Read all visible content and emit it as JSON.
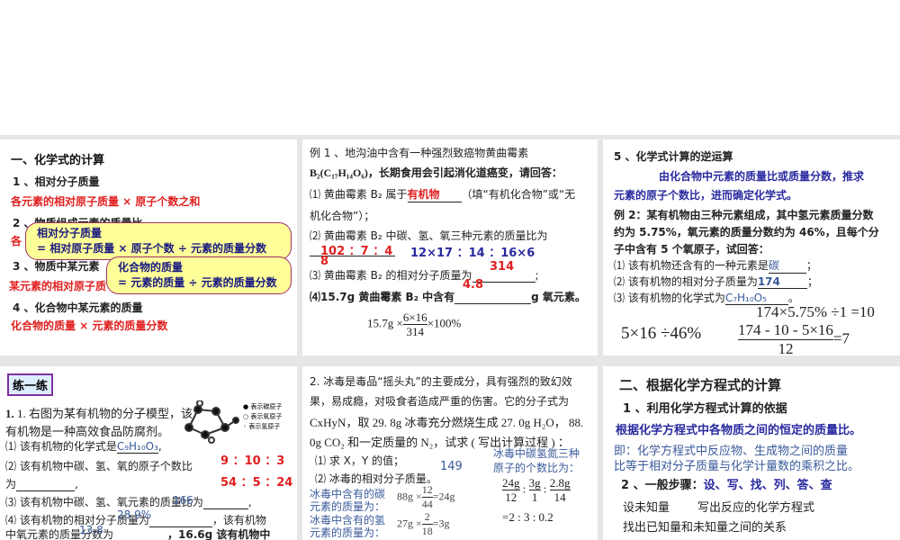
{
  "p1": {
    "title": "一、化学式的计算",
    "s1": "1 、相对分子质量",
    "s1a": "各元素的相对原子质量 × 原子个数之和",
    "s2": "2 、物质组成元素的质量比",
    "s2a": "各",
    "s3": "3 、物质中某元素",
    "s3a": "某元素的相对原子质",
    "s4": "4 、化合物中某元素的质量",
    "s4a": "化合物的质量 × 元素的质量分数",
    "callout1": [
      "相对分子质量",
      "= 相对原子质量 × 原子个数 ÷ 元素的质量分数"
    ],
    "callout2": [
      "化合物的质量",
      "= 元素的质量 ÷ 元素的质量分数"
    ]
  },
  "p2": {
    "l1": "例 1 、地沟油中含有一种强烈致癌物黄曲霉素",
    "l2": "B₂(C₁₇H₁₄O₆)，长期食用会引起消化道癌变，请回答：",
    "q1": "⑴ 黄曲霉素 B₂ 属于",
    "a1": "有机物",
    "q1b": "（填“有机化合物”或“无",
    "q1c": "机化合物”）；",
    "q2": "⑵ 黄曲霉素 B₂ 中碳、氢、氧三种元素的质量比为",
    "a2": "102 ：7 ：4",
    "a2b": "8",
    "a2c": "12×17 ：14 ：16×6",
    "q3": "⑶ 黄曲霉素 B₂ 的相对分子质量为",
    "a3": "314",
    "q4": "⑷15.7g 黄曲霉素 B₂ 中含有",
    "q4b": "g 氧元素。",
    "a4": "4.8",
    "f1": "15.7g ×",
    "fn": "6×16",
    "fd": "314",
    "f2": "×100%"
  },
  "p3": {
    "title": "5 、化学式计算的逆运算",
    "d1": "由化合物中元素的质量比或质量分数，推求",
    "d2": "元素的原子个数比，进而确定化学式。",
    "e1": "例 2：某有机物由三种元素组成，其中氢元素质量分数",
    "e2": "约为 5.75%，氧元素的质量分数约为 46%，且每个分",
    "e3": "子中含有 5 个氧原子，试回答：",
    "q1": "⑴ 该有机物还含有的一种元素是",
    "a1": "碳",
    "q2": "⑵ 该有机物的相对分子质量为",
    "a2": "174",
    "q3": "⑶ 该有机物的化学式为",
    "a3": "C₇H₁₀O₅",
    "c1": "174×5.75% ÷1 =10",
    "c2": "5×16 ÷46%",
    "c3n": "174 - 10 - 5×16",
    "c3d": "12",
    "c3r": "=7"
  },
  "p4": {
    "tag": "练一练",
    "l1": "1. 右图为某有机物的分子模型，该",
    "l2": "有机物是一种高效食品防腐剂。",
    "q1": "⑴ 该有机物的化学式是",
    "a1": "C₉H₁₀O₃",
    "q2": "⑵ 该有机物中碳、氢、氧的原子个数比",
    "q2b": "为",
    "a2": "9 ：10 ：3",
    "a3": "54 ：5 ：24",
    "q3": "⑶ 该有机物中碳、氢、氧元素的质量比为",
    "a3b": "166",
    "q4": "⑷ 该有机物的相对分子质量为",
    "q4b": "，该有机物",
    "a4": "28.9%",
    "q5": "中氧元素的质量分数为",
    "a5": "13.8",
    "q5b": "，16.6g 该有机物中",
    "legend": [
      "表示碳原子",
      "表示氧原子",
      "表示氢原子"
    ]
  },
  "p5": {
    "l1": "2. 冰毒是毒品“摇头丸”的主要成分，具有强烈的致幻效",
    "l2": "果，易成瘾，对吸食者造成严重的伤害。它的分子式为",
    "l3": "CxHyN，取 29. 8g 冰毒充分燃烧生成 27. 0g H₂O， 88.",
    "l4": "0g CO₂ 和一定质量的 N₂，试求 ( 写出计算过程 ) ：",
    "q1": "⑴ 求 X，Y 的值；",
    "q2": "⑵ 冰毒的相对分子质量。",
    "a2": "149",
    "c1": "冰毒中含有的碳",
    "c1b": "元素的质量为：",
    "f1": "88g ×",
    "f1n": "12",
    "f1d": "44",
    "f1r": "=24g",
    "c2": "冰毒中含有的氢",
    "c2b": "元素的质量为：",
    "f2": "27g ×",
    "f2n": "2",
    "f2d": "18",
    "f2r": "=3g",
    "r1": "冰毒中碳氢氮三种",
    "r2": "原子的个数比为：",
    "rn": [
      "24g",
      "3g",
      "2.8g"
    ],
    "rd": [
      "12",
      "1",
      "14"
    ],
    "rr": "=2 : 3 : 0.2"
  },
  "p6": {
    "title": "二、根据化学方程式的计算",
    "s1": "1 、利用化学方程式计算的依据",
    "b1": "根据化学方程式中各物质之间的恒定的质量比。",
    "b2": "即：化学方程式中反应物、生成物之间的质量",
    "b3": "比等于相对分子质量与化学计量数的乘积之比。",
    "s2": "2 、一般步骤：",
    "s2b": "设、写、找、列、答、查",
    "st1": "设未知量",
    "st2": "写出反应的化学方程式",
    "st3": "找出已知量和未知量之间的关系"
  }
}
